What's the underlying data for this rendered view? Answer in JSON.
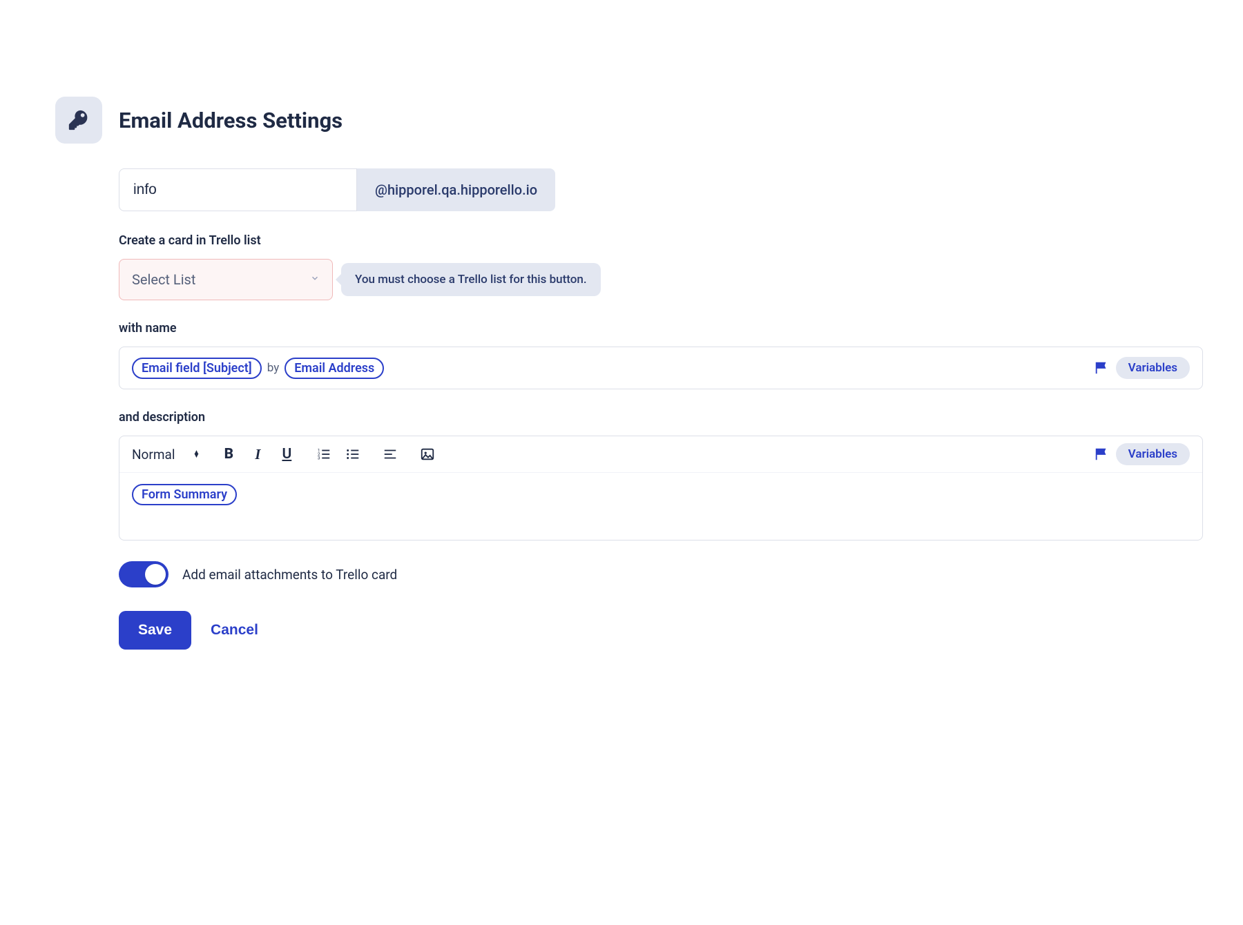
{
  "header": {
    "title": "Email Address Settings"
  },
  "email": {
    "local_part": "info",
    "domain_suffix": "@hipporel.qa.hipporello.io"
  },
  "trello_list": {
    "label": "Create a card in Trello list",
    "select_placeholder": "Select List",
    "hint": "You must choose a Trello list for this button."
  },
  "name_section": {
    "label": "with name",
    "pills": {
      "subject": "Email field [Subject]",
      "by": "by",
      "address": "Email Address"
    },
    "variables_label": "Variables"
  },
  "description_section": {
    "label": "and description",
    "format_label": "Normal",
    "body_pill": "Form Summary",
    "variables_label": "Variables"
  },
  "attachments_toggle": {
    "label": "Add email attachments to Trello card",
    "on": true
  },
  "actions": {
    "save": "Save",
    "cancel": "Cancel"
  }
}
